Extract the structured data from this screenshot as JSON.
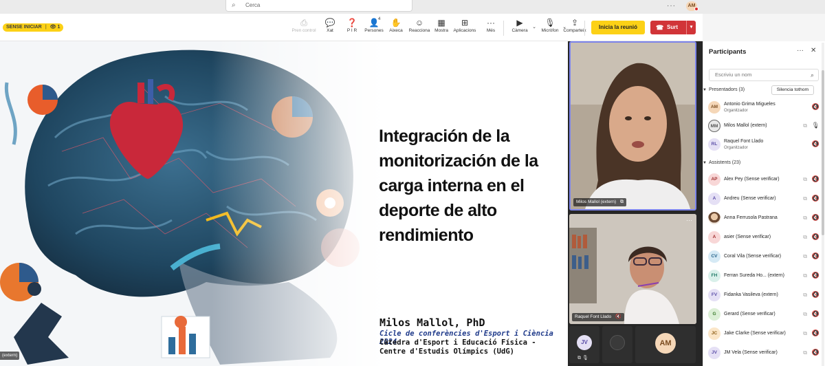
{
  "search": {
    "placeholder": "Cerca"
  },
  "user_avatar": "AM",
  "toolbar": {
    "status": "SENSE INICIAR",
    "viewers": "1",
    "items": [
      {
        "label": "Pren control",
        "icon": "take-control-icon",
        "glyph": "⎙",
        "disabled": true
      },
      {
        "label": "Xat",
        "icon": "chat-icon",
        "glyph": "💬"
      },
      {
        "label": "P I R",
        "icon": "qa-icon",
        "glyph": "❓"
      },
      {
        "label": "Persones",
        "icon": "people-icon",
        "glyph": "👤",
        "badge": "4"
      },
      {
        "label": "Aixeca",
        "icon": "raise-hand-icon",
        "glyph": "✋"
      },
      {
        "label": "Reacciona",
        "icon": "react-icon",
        "glyph": "☺"
      },
      {
        "label": "Mostra",
        "icon": "view-icon",
        "glyph": "▦"
      },
      {
        "label": "Aplicacions",
        "icon": "apps-icon",
        "glyph": "⊞"
      },
      {
        "label": "Més",
        "icon": "more-icon",
        "glyph": "···"
      },
      {
        "label": "Càmera",
        "icon": "camera-icon",
        "glyph": "▶"
      },
      {
        "label": "Micròfon",
        "icon": "microphone-icon",
        "glyph": "🎙"
      },
      {
        "label": "Comparteix",
        "icon": "share-icon",
        "glyph": "⇪"
      }
    ],
    "start_label": "Inicia la reunió",
    "leave_label": "Surt"
  },
  "slide": {
    "title": "Integración de la monitorización de la carga interna en el deporte de alto rendimiento",
    "speaker": "Milos Mallol, PhD",
    "cycle": "Cicle de conferències d'Esport i Ciència 2024",
    "chair": "Càtedra d'Esport i Educació Física - Centre d'Estudis Olímpics (UdG)",
    "left_tag": "(extern)"
  },
  "tiles": {
    "main_name": "Milos Mallol (extern)",
    "second_name": "Raquel Font Llado",
    "small": [
      {
        "initials": "JV",
        "bg": "#e5e0f5",
        "fg": "#5b4ea8"
      },
      {
        "initials": "",
        "bg": "#3a3a3a",
        "fg": "#999"
      },
      {
        "initials": "AM",
        "bg": "#f5d7b8",
        "fg": "#7a4b1f"
      }
    ]
  },
  "panel": {
    "title": "Participants",
    "search_placeholder": "Escriviu un nom",
    "presenters_header": "Presentadors (3)",
    "mute_all": "Silencia tothom",
    "attendees_header": "Assistents (23)",
    "presenters": [
      {
        "initials": "AM",
        "name": "Antonio Grima Migueles",
        "role": "Organitzador",
        "bg": "#f5d7b8",
        "fg": "#7a4b1f"
      },
      {
        "initials": "MM",
        "name": "Milos Mallol (extern)",
        "role": "",
        "bg": "#e8e8e8",
        "fg": "#555"
      },
      {
        "initials": "RL",
        "name": "Raquel Font Llado",
        "role": "Organitzador",
        "bg": "#e5e0f5",
        "fg": "#5b4ea8"
      }
    ],
    "attendees": [
      {
        "initials": "AP",
        "name": "Alex Pey (Sense verificar)",
        "bg": "#f8d7d7",
        "fg": "#a03030"
      },
      {
        "initials": "A",
        "name": "Andreu (Sense verificar)",
        "bg": "#e5e0f5",
        "fg": "#5b4ea8"
      },
      {
        "initials": "",
        "name": "Anna Ferrusola Pastrana",
        "bg": "",
        "fg": "",
        "photo": true
      },
      {
        "initials": "A",
        "name": "asier (Sense verificar)",
        "bg": "#f8d7d7",
        "fg": "#a03030"
      },
      {
        "initials": "CV",
        "name": "Coral Vila (Sense verificar)",
        "bg": "#d6eaf5",
        "fg": "#1f5e87"
      },
      {
        "initials": "FH",
        "name": "Ferran Sureda Ho... (extern)",
        "bg": "#d9f0ea",
        "fg": "#1f7a66"
      },
      {
        "initials": "FV",
        "name": "Fidanka Vasileva (extern)",
        "bg": "#e5e0f5",
        "fg": "#5b4ea8"
      },
      {
        "initials": "G",
        "name": "Gerard (Sense verificar)",
        "bg": "#dcefd6",
        "fg": "#3a7a2a"
      },
      {
        "initials": "JC",
        "name": "Jake Clarke (Sense verificar)",
        "bg": "#fbe6c8",
        "fg": "#8a5a12"
      },
      {
        "initials": "JV",
        "name": "JM Vela (Sense verificar)",
        "bg": "#e5e0f5",
        "fg": "#5b4ea8"
      }
    ]
  }
}
